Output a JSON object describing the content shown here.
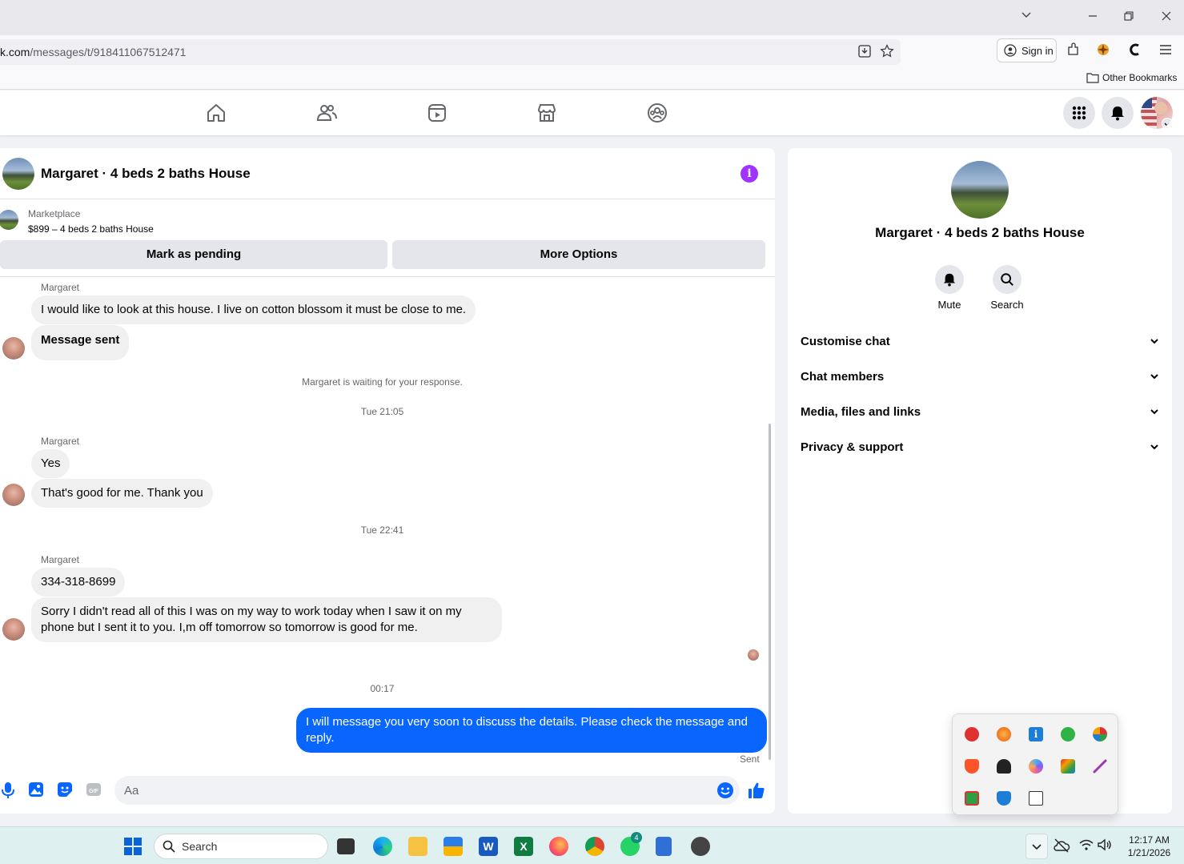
{
  "browser": {
    "url_domain": "k.com",
    "url_path": "/messages/t/918411067512471",
    "signin_label": "Sign in",
    "bookmarks_label": "Other Bookmarks"
  },
  "chat": {
    "title": "Margaret · 4 beds 2 baths House",
    "marketplace_label": "Marketplace",
    "listing": "$899 – 4 beds 2 baths House",
    "mark_pending": "Mark as pending",
    "more_options": "More Options",
    "messages": {
      "sender1": "Margaret",
      "m1": "I would like to look at this house. I live on cotton blossom it must be close to me.",
      "m2": "Message sent",
      "waiting": "Margaret is waiting for your response.",
      "time1": "Tue 21:05",
      "sender2": "Margaret",
      "m3": "Yes",
      "m4": "That's good for me. Thank you",
      "time2": "Tue 22:41",
      "sender3": "Margaret",
      "m5": "334-318-8699",
      "m6": "Sorry I didn't read all of this I was on my way to work today when I saw it on my phone but I sent it to you. I,m off tomorrow so tomorrow is good for me.",
      "time3": "00:17",
      "m7": "I will message you very soon to discuss the details. Please check the message and reply.",
      "sent_status": "Sent"
    },
    "composer_placeholder": "Aa"
  },
  "side": {
    "name": "Margaret · 4 beds 2 baths House",
    "mute_label": "Mute",
    "search_label": "Search",
    "sections": [
      "Customise chat",
      "Chat members",
      "Media, files and links",
      "Privacy & support"
    ]
  },
  "taskbar": {
    "search_label": "Search",
    "whatsapp_badge": "4",
    "time": "12:17 AM",
    "date": "1/21/2026"
  },
  "colors": {
    "accent": "#0866ff",
    "info": "#a033ff",
    "bubble": "#f0f0f0"
  }
}
